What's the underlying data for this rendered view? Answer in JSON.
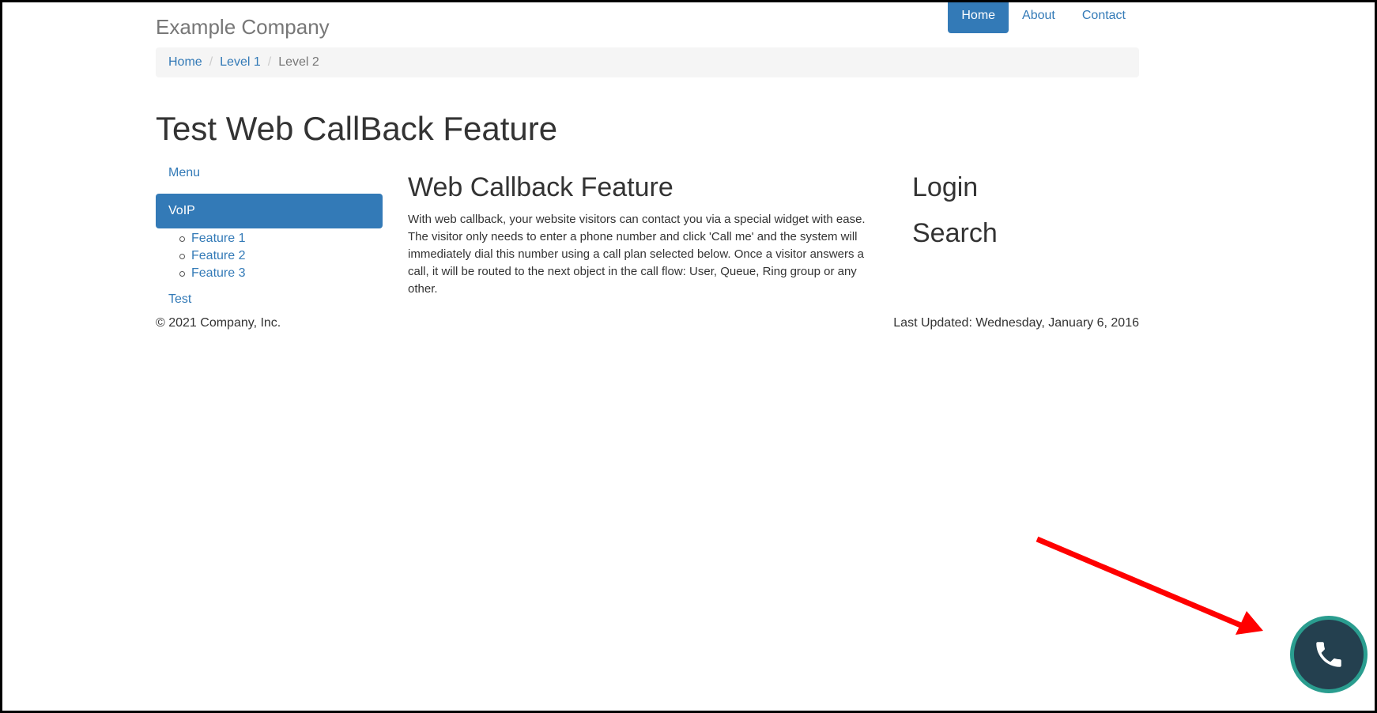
{
  "navbar": {
    "brand": "Example Company",
    "items": [
      {
        "label": "Home",
        "active": true
      },
      {
        "label": "About",
        "active": false
      },
      {
        "label": "Contact",
        "active": false
      }
    ]
  },
  "breadcrumb": {
    "items": [
      "Home",
      "Level 1"
    ],
    "current": "Level 2"
  },
  "page_title": "Test Web CallBack Feature",
  "sidebar": {
    "menu_label": "Menu",
    "active_label": "VoIP",
    "sub_items": [
      "Feature 1",
      "Feature 2",
      "Feature 3"
    ],
    "test_label": "Test"
  },
  "main": {
    "heading": "Web Callback Feature",
    "body": "With web callback, your website visitors can contact you via a special widget with ease. The visitor only needs to enter a phone number and click 'Call me' and the system will immediately dial this number using a call plan selected below. Once a visitor answers a call, it will be routed to the next object in the call flow: User, Queue, Ring group or any other."
  },
  "right": {
    "login_heading": "Login",
    "search_heading": "Search"
  },
  "footer": {
    "copyright": "© 2021 Company, Inc.",
    "last_updated": "Last Updated: Wednesday, January 6, 2016"
  },
  "widget": {
    "icon": "phone-icon",
    "bg_color": "#24404f",
    "ring_color": "#2a9d8f"
  },
  "colors": {
    "link": "#337ab7",
    "active_bg": "#337ab7",
    "annotation_arrow": "#ff0000"
  }
}
